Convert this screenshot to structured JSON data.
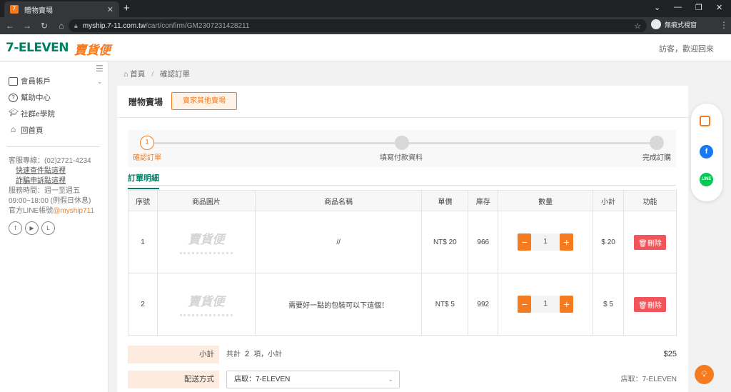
{
  "browser": {
    "tab_title": "贈物賣場",
    "favicon_text": "7",
    "url_host": "myship.7-11.com.tw",
    "url_path": "/cart/confirm/GM2307231428211",
    "profile_label": "無痕式視窗"
  },
  "header": {
    "logo_711": "7-ELEVEN",
    "logo_service": "賣貨便",
    "visitor_text": "訪客，歡迎回來"
  },
  "sidebar": {
    "items": [
      {
        "label": "會員帳戶",
        "icon": "wallet-icon"
      },
      {
        "label": "幫助中心",
        "icon": "question-icon"
      },
      {
        "label": "社群e學院",
        "icon": "graduation-cap-icon"
      },
      {
        "label": "回首頁",
        "icon": "home-icon"
      }
    ],
    "contact": {
      "phone": "客服專線：(02)2721-4234",
      "link1": "快速查件點這裡",
      "link2": "詐騙申訴點這裡",
      "hours1": "服務時間：週一至週五",
      "hours2": "09:00~18:00 (例假日休息)",
      "line_prefix": "官方LINE帳號",
      "line_id": "@myship711"
    }
  },
  "breadcrumb": {
    "home": "首頁",
    "current": "確認訂單"
  },
  "card": {
    "title": "贈物賣場",
    "other_button": "賣家其他賣場"
  },
  "steps": [
    {
      "num": "1",
      "label": "確認訂單",
      "active": true
    },
    {
      "num": "",
      "label": "填寫付款資料",
      "active": false
    },
    {
      "num": "",
      "label": "完成訂購",
      "active": false
    }
  ],
  "order_tab": "訂單明細",
  "table": {
    "headers": [
      "序號",
      "商品圖片",
      "商品名稱",
      "單價",
      "庫存",
      "數量",
      "小計",
      "功能"
    ],
    "rows": [
      {
        "no": "1",
        "name": "//",
        "price": "NT$ 20",
        "stock": "966",
        "qty": "1",
        "subtotal": "$ 20",
        "action": "刪除"
      },
      {
        "no": "2",
        "name": "需要好一點的包裝可以下這個！",
        "price": "NT$ 5",
        "stock": "992",
        "qty": "1",
        "subtotal": "$ 5",
        "action": "刪除"
      }
    ],
    "thumb_text": "賣貨便",
    "minus": "−",
    "plus": "+"
  },
  "summary": {
    "subtotal_label": "小計",
    "count_prefix": "共計",
    "count": "2",
    "count_suffix": "項，小計",
    "total": "$25",
    "shipping_label": "配送方式",
    "shipping_value": "店取：7-ELEVEN",
    "shipping_right": "店取：7-ELEVEN"
  }
}
